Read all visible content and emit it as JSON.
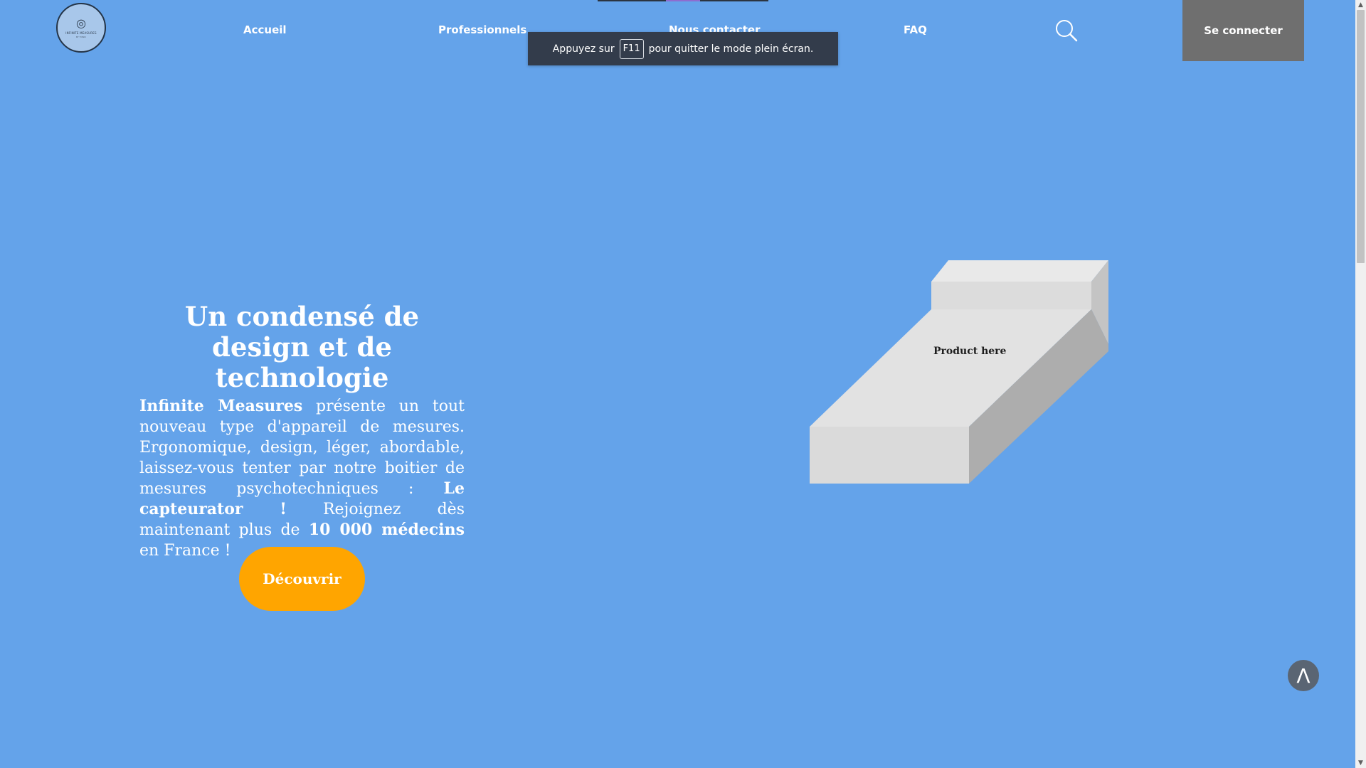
{
  "header": {
    "logo_text": "INFINITE MEASURES",
    "logo_subtext": "BY TONIC",
    "nav": [
      "Accueil",
      "Professionnels",
      "Nous contacter",
      "FAQ"
    ],
    "search_icon": "search-icon",
    "login_label": "Se connecter"
  },
  "fullscreen_notice": {
    "before": "Appuyez sur",
    "key": "F11",
    "after": "pour quitter le mode plein écran."
  },
  "hero": {
    "title": "Un condensé de design et de technologie",
    "brand": "Infinite Measures",
    "text_1": " présente un tout nouveau type d'appareil de mesures. Ergonomique, design, léger, abordable, laissez-vous tenter par notre boitier de mesures psychotechniques : ",
    "product_name": "Le capteurator !",
    "text_2": " Rejoignez dès maintenant plus de ",
    "doctor_count": "10 000 médecins",
    "text_3": " en France !",
    "cta_label": "Découvrir"
  },
  "product": {
    "label": "Product here"
  },
  "back_to_top": {
    "label": "Λ",
    "icon": "chevron-up-icon"
  },
  "colors": {
    "background": "#64a3ea",
    "cta": "#ffa500",
    "login": "#6f6f6f",
    "toast": "#333c4b"
  }
}
